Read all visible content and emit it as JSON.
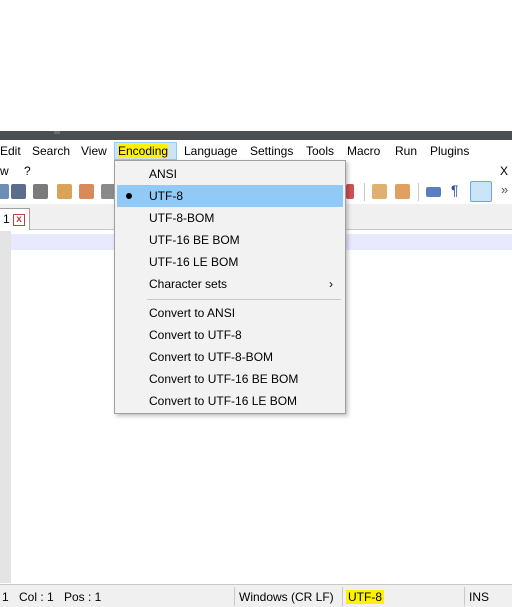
{
  "menubar": {
    "items": [
      {
        "label": "Edit"
      },
      {
        "label": "Search"
      },
      {
        "label": "View"
      },
      {
        "label": "Encoding"
      },
      {
        "label": "Language"
      },
      {
        "label": "Settings"
      },
      {
        "label": "Tools"
      },
      {
        "label": "Macro"
      },
      {
        "label": "Run"
      },
      {
        "label": "Plugins"
      }
    ],
    "row2": [
      "w",
      "?"
    ],
    "close": "X"
  },
  "toolbar": {
    "overflow": "»",
    "pilcrow": "¶"
  },
  "tab": {
    "label": "1",
    "close_glyph": "x"
  },
  "encoding_menu": {
    "items": [
      {
        "label": "ANSI"
      },
      {
        "label": "UTF-8",
        "checked": true
      },
      {
        "label": "UTF-8-BOM"
      },
      {
        "label": "UTF-16 BE BOM"
      },
      {
        "label": "UTF-16 LE BOM"
      },
      {
        "label": "Character sets",
        "submenu_arrow": "›"
      }
    ],
    "convert_items": [
      {
        "label": "Convert to ANSI"
      },
      {
        "label": "Convert to UTF-8"
      },
      {
        "label": "Convert to UTF-8-BOM"
      },
      {
        "label": "Convert to UTF-16 BE BOM"
      },
      {
        "label": "Convert to UTF-16 LE BOM"
      }
    ]
  },
  "statusbar": {
    "lines": "1",
    "col": "Col : 1",
    "pos": "Pos : 1",
    "eol": "Windows (CR LF)",
    "encoding": "UTF-8",
    "mode": "INS"
  },
  "colors": {
    "highlight": "#fff200",
    "menu_selected": "#91c9f7",
    "title_strip": "#4b4f52"
  }
}
